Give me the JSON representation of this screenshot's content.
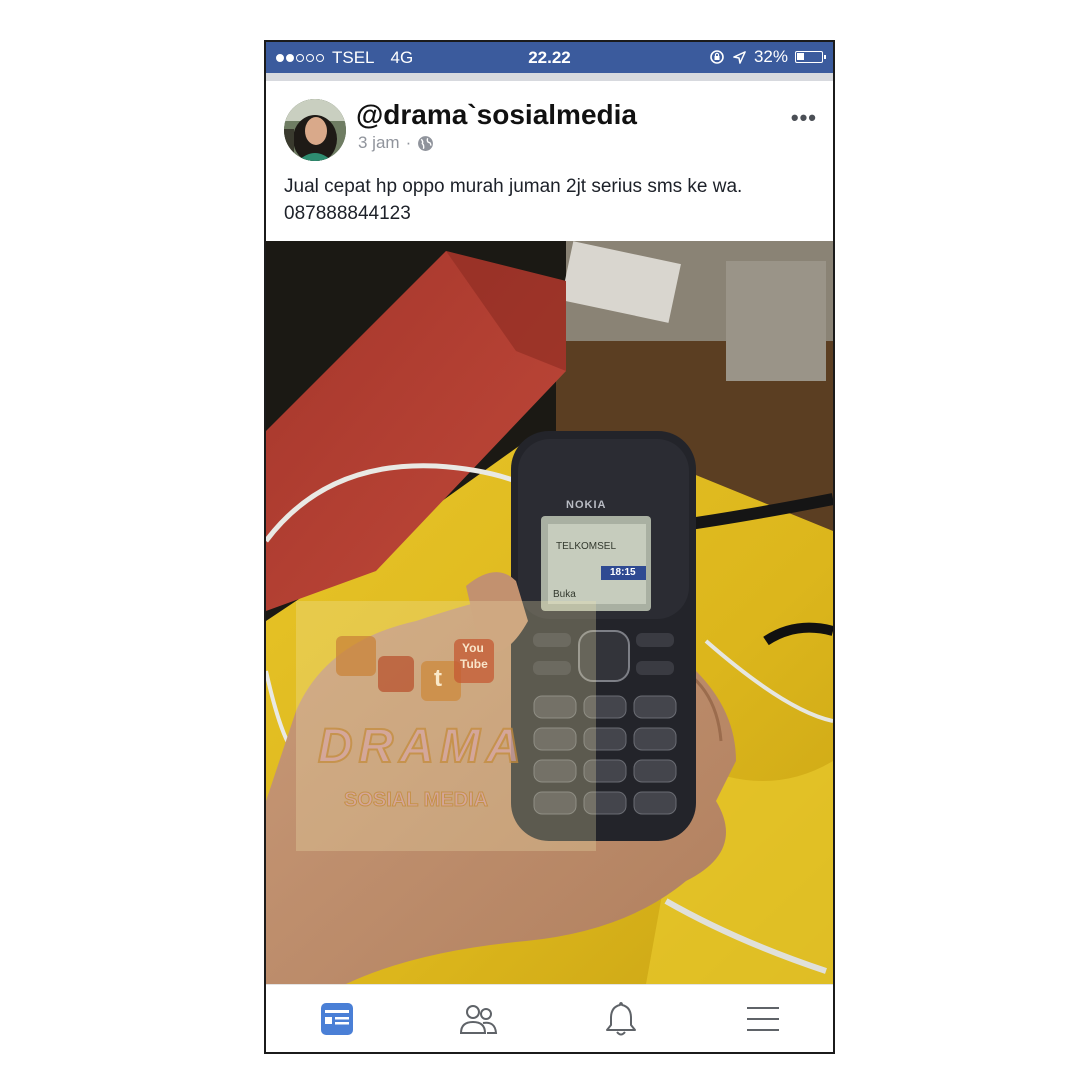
{
  "status_bar": {
    "carrier": "TSEL",
    "network": "4G",
    "time": "22.22",
    "battery": "32%",
    "battery_level": 0.32,
    "signal_bars_filled": 2,
    "signal_bars_total": 5
  },
  "post": {
    "username": "@drama`sosialmedia",
    "time_ago": "3 jam",
    "separator": "·",
    "more_label": "•••",
    "text_line1": "Jual cepat hp oppo murah juman 2jt serius sms ke wa.",
    "text_line2": "087888844123"
  },
  "photo": {
    "phone_brand": "NOKIA",
    "screen_operator": "TELKOMSEL",
    "screen_clock": "18:15",
    "screen_softkey": "Buka",
    "watermark_title": "DRAMA",
    "watermark_subtitle": "SOSIAL MEDIA",
    "watermark_badge_1": "You",
    "watermark_badge_2": "Tube",
    "watermark_badge_3": "t"
  },
  "tabbar": {
    "tabs": [
      {
        "icon": "news-feed-icon",
        "active": true
      },
      {
        "icon": "friends-icon",
        "active": false
      },
      {
        "icon": "notifications-bell-icon",
        "active": false
      },
      {
        "icon": "menu-icon",
        "active": false
      }
    ]
  },
  "colors": {
    "status_bar": "#3b5b9d",
    "active_tab": "#4a7fd6",
    "inactive_tab": "#5f6368"
  }
}
